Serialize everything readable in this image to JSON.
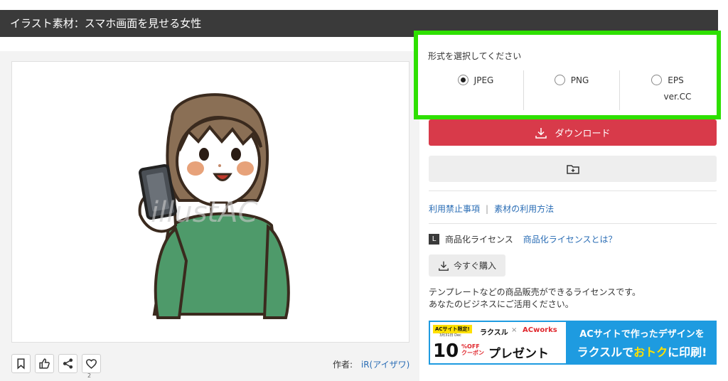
{
  "header": {
    "title": "イラスト素材：スマホ画面を見せる女性"
  },
  "preview": {
    "watermark": "illustAC"
  },
  "actions": {
    "like_count": "2",
    "author_label": "作者:",
    "author_name": "iR(アイザワ)"
  },
  "format": {
    "title": "形式を選択してください",
    "options": [
      {
        "label": "JPEG",
        "selected": true,
        "sub": ""
      },
      {
        "label": "PNG",
        "selected": false,
        "sub": ""
      },
      {
        "label": "EPS",
        "selected": false,
        "sub": "ver.CC"
      }
    ]
  },
  "download": {
    "label": "ダウンロード"
  },
  "links": {
    "prohibited": "利用禁止事項",
    "separator": "|",
    "usage": "素材の利用方法"
  },
  "license": {
    "badge": "L",
    "label": "商品化ライセンス",
    "link": "商品化ライセンスとは？",
    "buy_label": "今すぐ購入",
    "desc_line1": "テンプレートなどの商品販売ができるライセンスです。",
    "desc_line2": "あなたのビジネスにご活用ください。"
  },
  "banner": {
    "tag": "ACサイト限定!",
    "date": "3月31日 Dec",
    "raksul": "ラクスル",
    "times": "×",
    "acworks": "ACworks",
    "discount": "10",
    "off": "%OFF",
    "coupon": "クーポン",
    "present": "プレゼント",
    "right_line1": "ACサイトで作ったデザインを",
    "right_line2a": "ラクスルで",
    "right_line2b": "おトク",
    "right_line2c": "に印刷!"
  },
  "colors": {
    "header_bg": "#3a3a3a",
    "download_red": "#d83a4a",
    "highlight_green": "#2ee000",
    "link_blue": "#2a6db5",
    "sweater_green": "#4e9a6a",
    "banner_blue": "#1e9be0"
  }
}
